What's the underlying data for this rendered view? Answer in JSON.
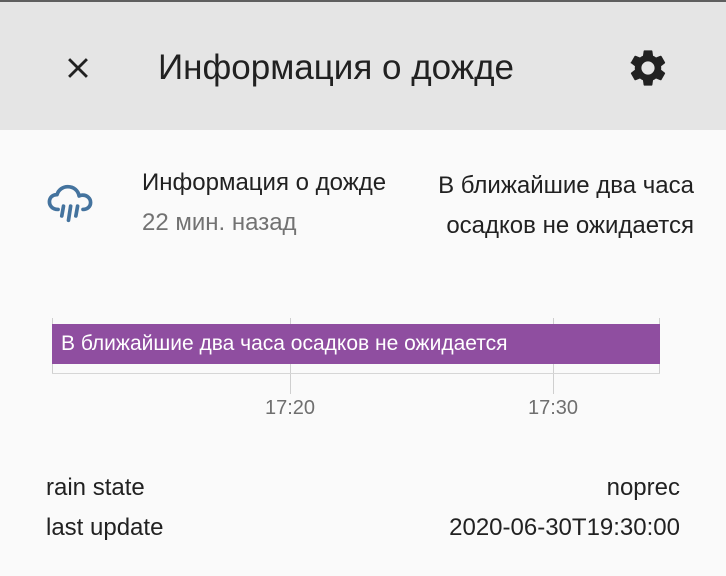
{
  "dialog": {
    "title": "Информация о дожде",
    "close_icon": "close-icon",
    "settings_icon": "gear-icon"
  },
  "entity": {
    "icon": "weather-pouring-icon",
    "icon_color": "#44739e",
    "name": "Информация о дожде",
    "last_changed": "22 мин. назад",
    "state": "В ближайшие два часа осадков не ожидается"
  },
  "timeline": {
    "bar_label": "В ближайшие два часа осадков не ожидается",
    "bar_color": "#8f4ea0",
    "ticks": [
      "17:20",
      "17:30"
    ]
  },
  "attributes": [
    {
      "name": "rain state",
      "value": "noprec"
    },
    {
      "name": "last update",
      "value": "2020-06-30T19:30:00"
    }
  ]
}
